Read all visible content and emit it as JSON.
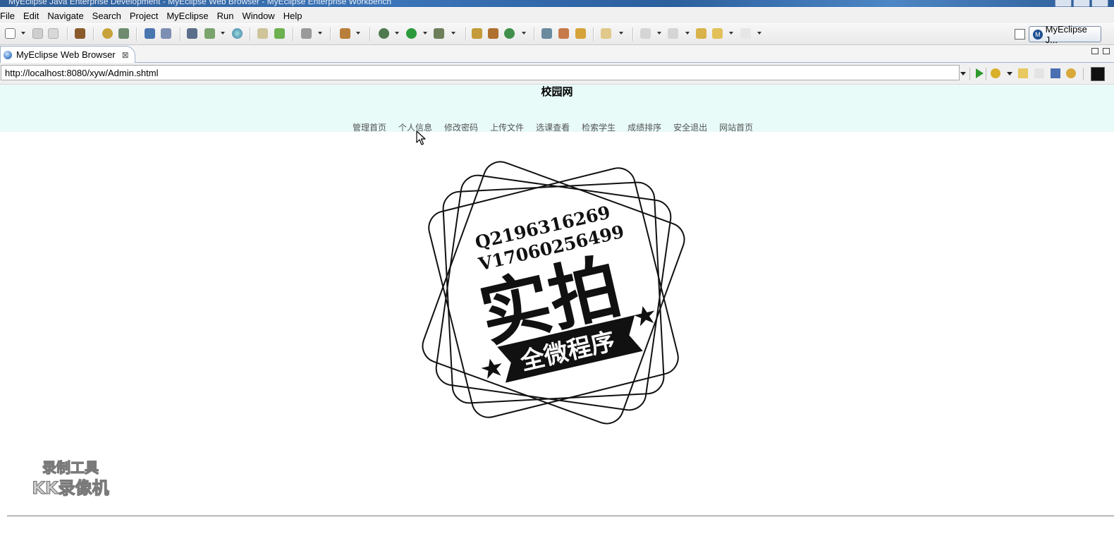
{
  "window": {
    "title": "MyEclipse Java Enterprise Development - MyEclipse Web Browser - MyEclipse Enterprise Workbench"
  },
  "menu": {
    "items": [
      "File",
      "Edit",
      "Navigate",
      "Search",
      "Project",
      "MyEclipse",
      "Run",
      "Window",
      "Help"
    ]
  },
  "toolbar": {
    "perspective_label": "MyEclipse J..."
  },
  "editor_tab": {
    "label": "MyEclipse Web Browser",
    "close_symbol": "⊠"
  },
  "address_bar": {
    "url": "http://localhost:8080/xyw/Admin.shtml"
  },
  "page": {
    "site_title": "校园网",
    "nav": [
      "管理首页",
      "个人信息",
      "修改密码",
      "上传文件",
      "选课查看",
      "检索学生",
      "成绩排序",
      "安全退出",
      "网站首页"
    ]
  },
  "stamp": {
    "line1": "Q2196316269",
    "line2": "V17060256499",
    "main": "实拍",
    "ribbon": "全微程序"
  },
  "watermark": {
    "line1": "录制工具",
    "line2": "KK录像机"
  }
}
